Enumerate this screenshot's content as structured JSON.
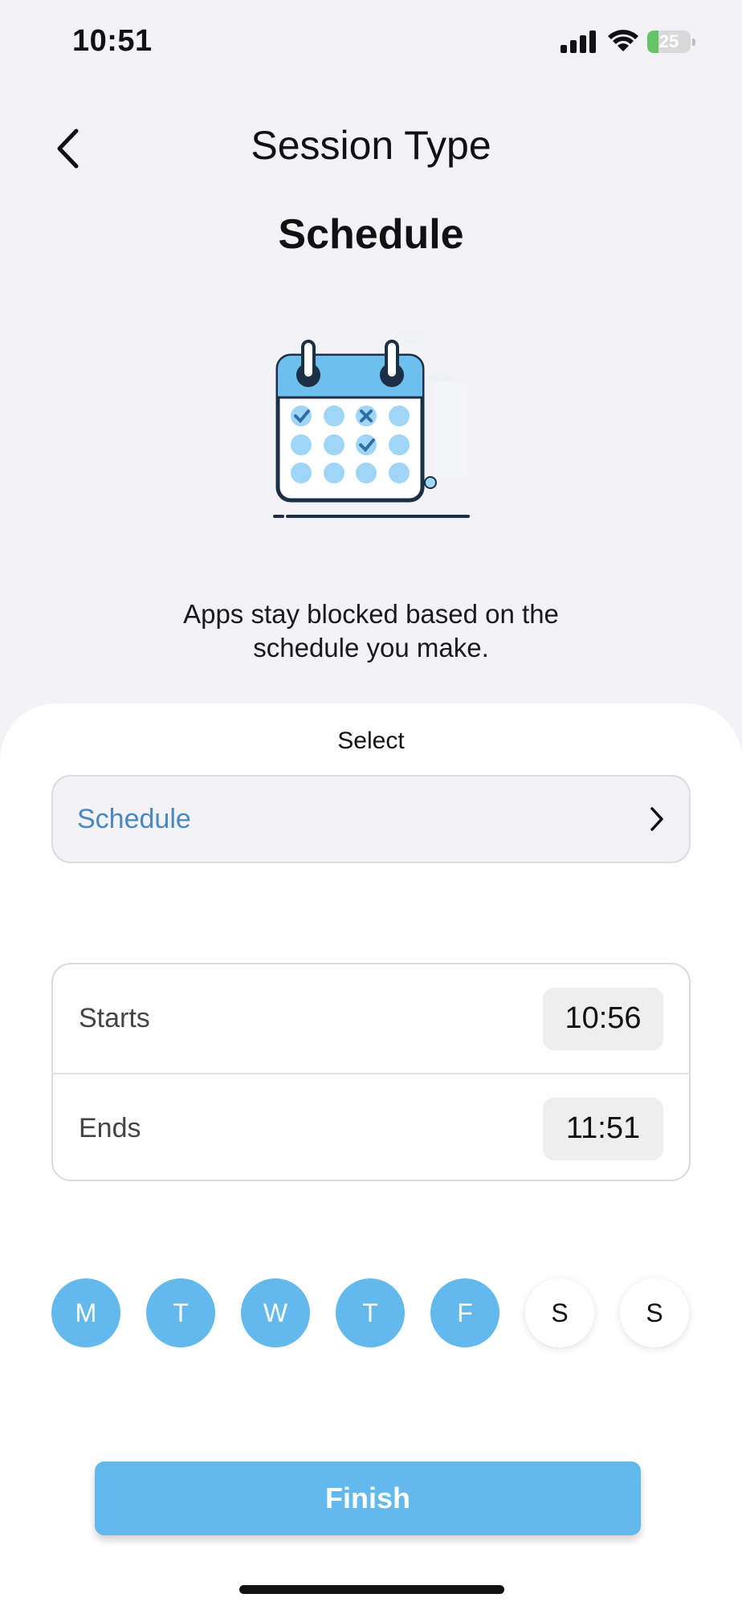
{
  "status_bar": {
    "time": "10:51",
    "battery_text": "25",
    "battery_level": 0.25,
    "battery_color": "#65c466"
  },
  "nav": {
    "back_icon": "chevron-left-icon",
    "title": "Session Type"
  },
  "heading": "Schedule",
  "illustration": "calendar-illustration",
  "description": "Apps stay blocked based on the schedule you make.",
  "sheet": {
    "select_label": "Select",
    "session_option": {
      "label": "Schedule",
      "icon": "chevron-right-icon"
    },
    "times": {
      "starts_label": "Starts",
      "starts_value": "10:56",
      "ends_label": "Ends",
      "ends_value": "11:51"
    },
    "days": [
      {
        "label": "M",
        "selected": true
      },
      {
        "label": "T",
        "selected": true
      },
      {
        "label": "W",
        "selected": true
      },
      {
        "label": "T",
        "selected": true
      },
      {
        "label": "F",
        "selected": true
      },
      {
        "label": "S",
        "selected": false
      },
      {
        "label": "S",
        "selected": false
      }
    ],
    "finish_label": "Finish"
  },
  "colors": {
    "accent": "#63b9ec",
    "link": "#4a88c0",
    "background": "#f2f2f7"
  }
}
